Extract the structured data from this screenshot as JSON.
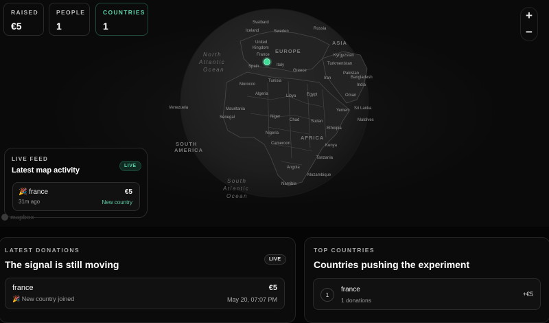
{
  "stats": [
    {
      "label": "RAISED",
      "value": "€5"
    },
    {
      "label": "PEOPLE",
      "value": "1"
    },
    {
      "label": "COUNTRIES",
      "value": "1"
    }
  ],
  "zoom": {
    "in": "+",
    "out": "−"
  },
  "map_labels": {
    "svalbard": "Svalbard",
    "iceland": "Iceland",
    "sweden": "Sweden",
    "russia": "Russia",
    "united_kingdom": "United Kingdom",
    "france": "France",
    "europe": "EUROPE",
    "spain": "Spain",
    "italy": "Italy",
    "greece": "Greece",
    "asia": "ASIA",
    "kyrgyzstan": "Kyrgyzstan",
    "turkmenistan": "Turkmenistan",
    "pakistan": "Pakistan",
    "iran": "Iran",
    "bangladesh": "Bangladesh",
    "india": "India",
    "oman": "Oman",
    "yemen": "Yemen",
    "sri_lanka": "Sri Lanka",
    "maldives": "Maldives",
    "morocco": "Morocco",
    "tunisia": "Tunisia",
    "algeria": "Algeria",
    "libya": "Libya",
    "egypt": "Egypt",
    "mauritania": "Mauritania",
    "senegal": "Senegal",
    "niger": "Niger",
    "chad": "Chad",
    "sudan": "Sudan",
    "ethiopia": "Ethiopia",
    "nigeria": "Nigeria",
    "cameroon": "Cameroon",
    "africa": "AFRICA",
    "kenya": "Kenya",
    "tanzania": "Tanzania",
    "angola": "Angola",
    "mozambique": "Mozambique",
    "namibia": "Namibia",
    "venezuela": "Venezuela",
    "south_america": "SOUTH AMERICA",
    "north_atlantic": "North Atlantic Ocean",
    "south_atlantic": "South Atlantic Ocean"
  },
  "live_feed": {
    "kicker": "LIVE FEED",
    "title": "Latest map activity",
    "badge": "LIVE",
    "item": {
      "flag": "🎉",
      "country": "france",
      "time": "31m ago",
      "amount": "€5",
      "tag": "New country"
    }
  },
  "attribution": "mapbox",
  "latest_donations": {
    "kicker": "LATEST DONATIONS",
    "title": "The signal is still moving",
    "badge": "LIVE",
    "items": [
      {
        "country": "france",
        "flag": "🎉",
        "note": "New country joined",
        "amount": "€5",
        "date": "May 20, 07:07 PM"
      }
    ]
  },
  "top_countries": {
    "kicker": "TOP COUNTRIES",
    "title": "Countries pushing the experiment",
    "items": [
      {
        "rank": "1",
        "country": "france",
        "donations": "1 donations",
        "amount": "+€5"
      }
    ]
  },
  "colors": {
    "accent": "#3ddc97",
    "background": "#050505"
  }
}
